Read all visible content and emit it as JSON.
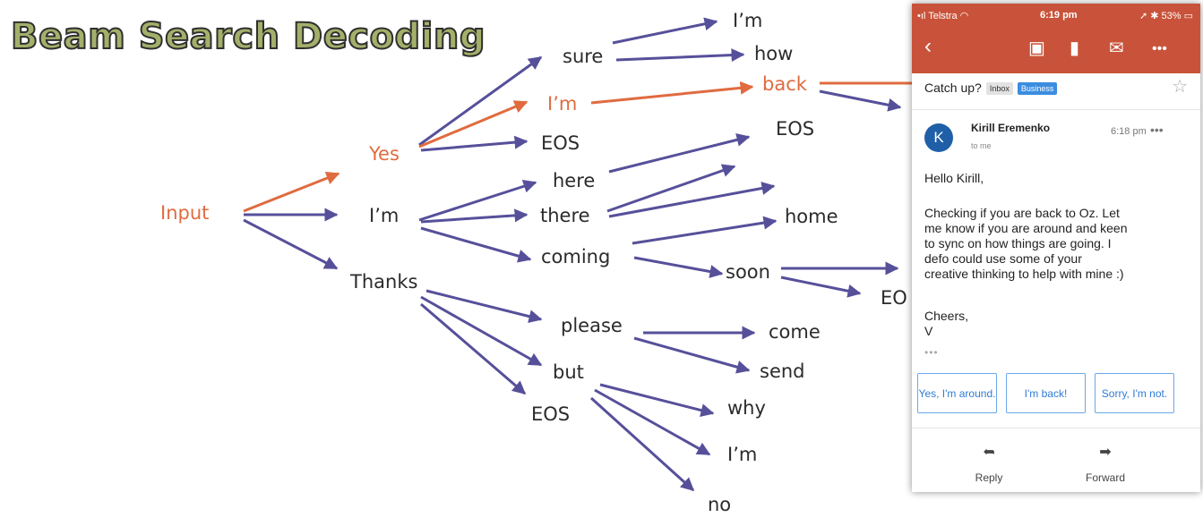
{
  "title": "Beam Search Decoding",
  "colors": {
    "highlight": "#e06b3f",
    "arrow": "#56509a",
    "title_fill": "#a3b06a",
    "header": "#c9533a",
    "link": "#2f7bd6"
  },
  "tree": {
    "input": "Input",
    "yes": "Yes",
    "im1": "I’m",
    "thanks": "Thanks",
    "sure": "sure",
    "im2": "I’m",
    "eos1": "EOS",
    "im3": "I’m",
    "how": "how",
    "back": "back",
    "here": "here",
    "there": "there",
    "coming": "coming",
    "eos2": "EOS",
    "home": "home",
    "soon": "soon",
    "eos3": "EO",
    "please": "please",
    "but": "but",
    "eos4": "EOS",
    "come": "come",
    "send": "send",
    "why": "why",
    "im4": "I’m",
    "no": "no"
  },
  "phone": {
    "status": {
      "carrier": "Telstra",
      "time": "6:19 pm",
      "battery": "53%"
    },
    "toolbar_icons": [
      "back-chevron-icon",
      "archive-icon",
      "trash-icon",
      "mail-icon",
      "more-icon"
    ],
    "subject": "Catch up?",
    "labels": {
      "inbox": "Inbox",
      "business": "Business"
    },
    "sender": "Kirill Eremenko",
    "avatar_letter": "K",
    "to": "to me",
    "time": "6:18 pm",
    "greeting": "Hello Kirill,",
    "body": "Checking if you are back to Oz. Let\nme know if you are around and keen\nto sync on how things are going. I\ndefo could use some of your\ncreative thinking to help with mine :)",
    "signoff": "Cheers,\nV",
    "smart_replies": [
      "Yes, I'm around.",
      "I'm back!",
      "Sorry, I'm not."
    ],
    "actions": {
      "reply": "Reply",
      "forward": "Forward"
    }
  }
}
